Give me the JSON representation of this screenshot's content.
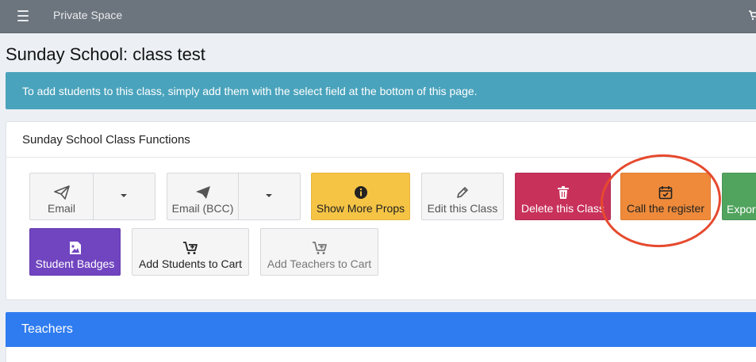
{
  "nav": {
    "brand": "Private Space"
  },
  "page": {
    "title": "Sunday School: class test"
  },
  "alert": {
    "text": "To add students to this class, simply add them with the select field at the bottom of this page."
  },
  "functions": {
    "header": "Sunday School Class Functions",
    "buttons": [
      {
        "label": "Email",
        "icon": "paper-plane-outline-icon",
        "style": "light"
      },
      {
        "label": "Email (BCC)",
        "icon": "paper-plane-icon",
        "style": "light"
      },
      {
        "label": "Show More Props",
        "icon": "info-circle-icon",
        "style": "yellow"
      },
      {
        "label": "Edit this Class",
        "icon": "pencil-icon",
        "style": "light"
      },
      {
        "label": "Delete this Class",
        "icon": "trash-icon",
        "style": "red"
      },
      {
        "label": "Call the register",
        "icon": "calendar-check-icon",
        "style": "orange"
      },
      {
        "label": "Export",
        "style": "green"
      },
      {
        "label": "Student Badges",
        "icon": "image-icon",
        "style": "purple"
      },
      {
        "label": "Add Students to Cart",
        "icon": "cart-plus-icon",
        "style": "light"
      },
      {
        "label": "Add Teachers to Cart",
        "icon": "cart-plus-icon",
        "style": "light"
      }
    ]
  },
  "teachers": {
    "header": "Teachers"
  },
  "colors": {
    "yellow": "#f5c445",
    "red": "#c8315a",
    "orange": "#ee8a3a",
    "green": "#51a45e",
    "purple": "#7145c0",
    "alert": "#4aa3bc",
    "teachers": "#2f7cf0",
    "highlight_circle": "#e64a2e"
  }
}
